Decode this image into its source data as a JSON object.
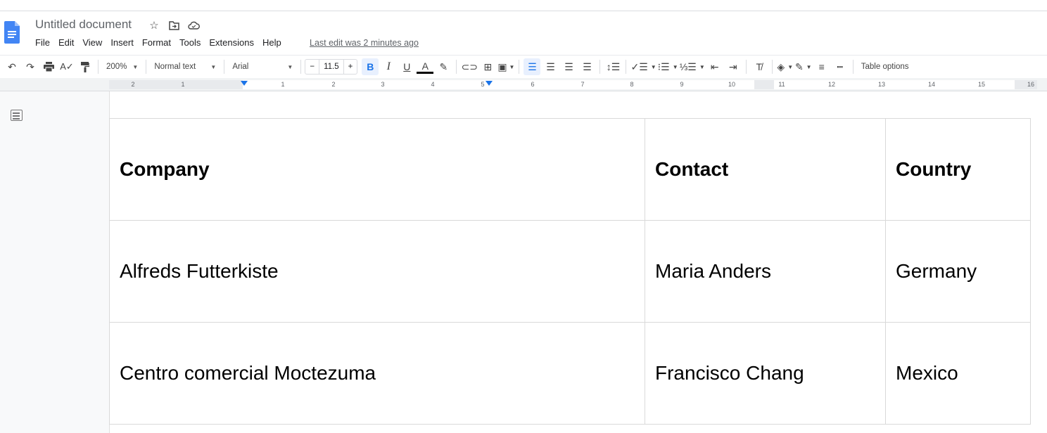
{
  "app": {
    "title": "Untitled document",
    "last_edit": "Last edit was 2 minutes ago",
    "accent": "#1a73e8"
  },
  "title_icons": [
    "star-icon",
    "move-to-folder-icon",
    "cloud-saved-icon"
  ],
  "menu": [
    "File",
    "Edit",
    "View",
    "Insert",
    "Format",
    "Tools",
    "Extensions",
    "Help"
  ],
  "toolbar": {
    "zoom": "200%",
    "style": "Normal text",
    "font": "Arial",
    "font_size": "11.5",
    "decrease": "−",
    "increase": "+",
    "bold": "B",
    "italic": "I",
    "underline": "U",
    "text_color": "A",
    "table_options": "Table options"
  },
  "ruler": {
    "labels": [
      "2",
      "1",
      "1",
      "2",
      "3",
      "4",
      "5",
      "6",
      "7",
      "8",
      "9",
      "10",
      "11",
      "12",
      "13",
      "14",
      "15",
      "16"
    ]
  },
  "table": {
    "headers": [
      "Company",
      "Contact",
      "Country"
    ],
    "rows": [
      [
        "Alfreds Futterkiste",
        "Maria Anders",
        "Germany"
      ],
      [
        "Centro comercial Moctezuma",
        "Francisco Chang",
        "Mexico"
      ]
    ]
  }
}
